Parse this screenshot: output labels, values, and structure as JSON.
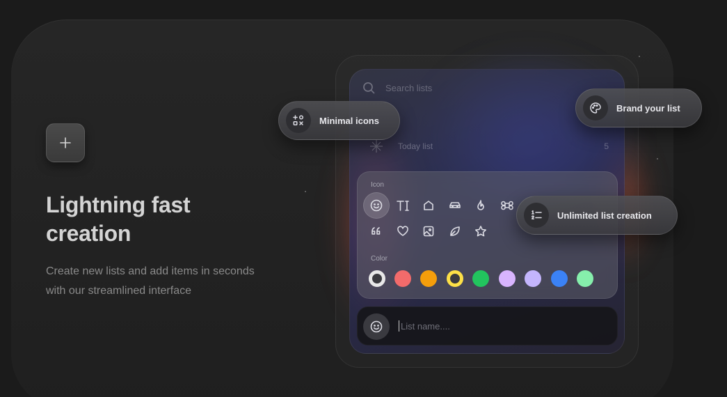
{
  "hero": {
    "title": "Lightning fast creation",
    "description": "Create new lists and add items in seconds with our streamlined interface"
  },
  "app": {
    "search_placeholder": "Search lists",
    "today_list_label": "Today list",
    "today_list_count": "5",
    "icon_section_label": "Icon",
    "color_section_label": "Color",
    "icons": [
      "smiley-icon",
      "text-icon",
      "home-icon",
      "car-icon",
      "flame-icon",
      "command-icon",
      "quote-icon",
      "heart-icon",
      "picture-icon",
      "leaf-icon",
      "star-icon"
    ],
    "selected_icon": "smiley-icon",
    "colors": [
      "#e8e8e8",
      "#f26b6b",
      "#f59e0b",
      "#fde047",
      "#22c55e",
      "#d8b4fe",
      "#c4b5fd",
      "#3b82f6",
      "#86efac"
    ],
    "selected_colors": [
      "#e8e8e8",
      "#fde047"
    ],
    "name_placeholder": "List name...."
  },
  "features": {
    "minimal_icons": "Minimal icons",
    "brand_list": "Brand your list",
    "unlimited_lists": "Unlimited list creation"
  }
}
